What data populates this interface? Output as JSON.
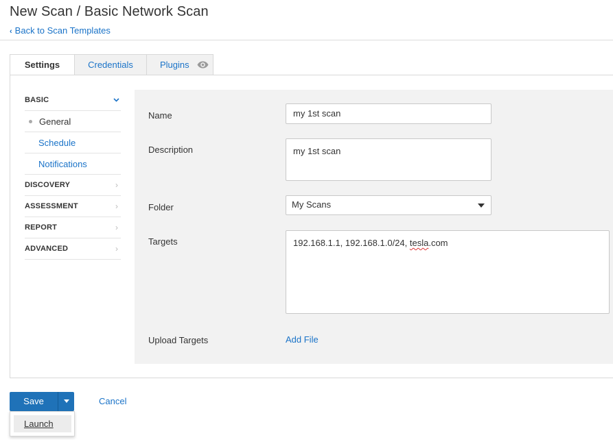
{
  "header": {
    "title": "New Scan / Basic Network Scan",
    "back_label": "Back to Scan Templates"
  },
  "tabs": [
    {
      "label": "Settings",
      "active": true
    },
    {
      "label": "Credentials",
      "active": false
    },
    {
      "label": "Plugins",
      "active": false,
      "icon": "eye-icon"
    }
  ],
  "sidebar": {
    "sections": [
      {
        "label": "BASIC",
        "expanded": true,
        "items": [
          {
            "label": "General",
            "current": true
          },
          {
            "label": "Schedule",
            "current": false
          },
          {
            "label": "Notifications",
            "current": false
          }
        ]
      },
      {
        "label": "DISCOVERY",
        "expanded": false
      },
      {
        "label": "ASSESSMENT",
        "expanded": false
      },
      {
        "label": "REPORT",
        "expanded": false
      },
      {
        "label": "ADVANCED",
        "expanded": false
      }
    ]
  },
  "form": {
    "name_label": "Name",
    "name_value": "my 1st scan",
    "description_label": "Description",
    "description_value": "my 1st scan",
    "folder_label": "Folder",
    "folder_value": "My Scans",
    "targets_label": "Targets",
    "targets_prefix": "192.168.1.1, 192.168.1.0/24, ",
    "targets_misspelled": "tesla",
    "targets_suffix": ".com",
    "upload_label": "Upload Targets",
    "add_file_label": "Add File"
  },
  "actions": {
    "save_label": "Save",
    "cancel_label": "Cancel",
    "dropdown_items": [
      "Launch"
    ]
  },
  "colors": {
    "link": "#1a73c8",
    "primary_button": "#1f72b8",
    "form_background": "#f2f2f2"
  }
}
